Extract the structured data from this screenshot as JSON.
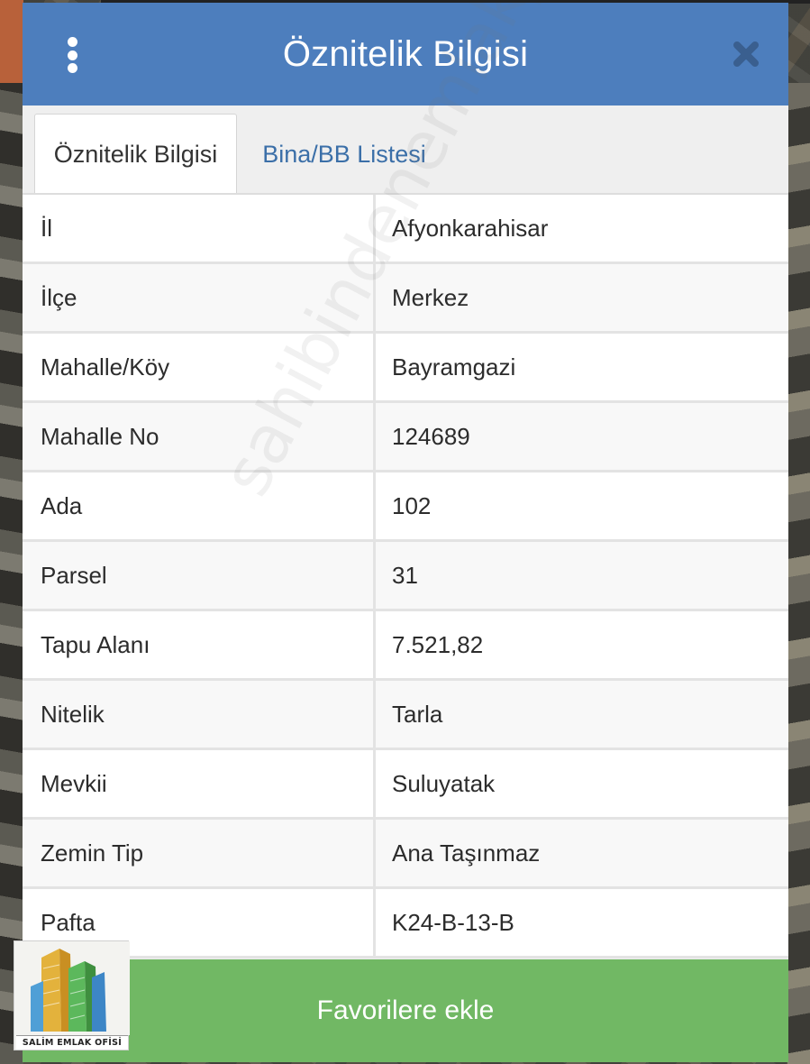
{
  "header": {
    "title": "Öznitelik Bilgisi",
    "menu_icon": "kebab-menu-icon",
    "close_icon": "close-icon"
  },
  "tabs": [
    {
      "label": "Öznitelik Bilgisi",
      "active": true
    },
    {
      "label": "Bina/BB Listesi",
      "active": false
    }
  ],
  "attributes": [
    {
      "label": "İl",
      "value": "Afyonkarahisar"
    },
    {
      "label": "İlçe",
      "value": "Merkez"
    },
    {
      "label": "Mahalle/Köy",
      "value": "Bayramgazi"
    },
    {
      "label": "Mahalle No",
      "value": "124689"
    },
    {
      "label": "Ada",
      "value": "102"
    },
    {
      "label": "Parsel",
      "value": "31"
    },
    {
      "label": "Tapu Alanı",
      "value": "7.521,82"
    },
    {
      "label": "Nitelik",
      "value": "Tarla"
    },
    {
      "label": "Mevkii",
      "value": "Suluyatak"
    },
    {
      "label": "Zemin Tip",
      "value": "Ana Taşınmaz"
    },
    {
      "label": "Pafta",
      "value": "K24-B-13-B"
    }
  ],
  "footer": {
    "favorite_label": "Favorilere ekle"
  },
  "watermark": "sahibindenemlakjet.com",
  "logo": {
    "text": "SALİM EMLAK OFİSİ"
  },
  "colors": {
    "header_bg": "#4d7ebd",
    "tab_link": "#3b6fa8",
    "favorite_bg": "#71b864"
  }
}
